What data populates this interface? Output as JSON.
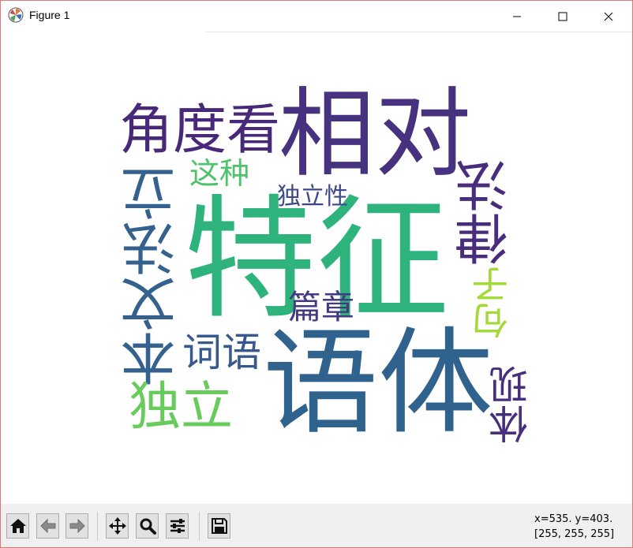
{
  "window": {
    "title": "Figure 1",
    "app_icon": "matplotlib-icon",
    "controls": {
      "minimize": "minimize-icon",
      "maximize": "maximize-icon",
      "close": "close-icon"
    }
  },
  "wordcloud": {
    "words": [
      {
        "text": "特征",
        "color": "#2eb37c"
      },
      {
        "text": "语体",
        "color": "#30628e"
      },
      {
        "text": "相对",
        "color": "#46327f"
      },
      {
        "text": "角度看",
        "color": "#482878"
      },
      {
        "text": "本文法立",
        "color": "#34618d"
      },
      {
        "text": "词语",
        "color": "#37598c"
      },
      {
        "text": "律法",
        "color": "#472d7b"
      },
      {
        "text": "句子",
        "color": "#a2da37"
      },
      {
        "text": "体现",
        "color": "#472f7d"
      },
      {
        "text": "独立",
        "color": "#67cc5c"
      },
      {
        "text": "篇章",
        "color": "#443a83"
      },
      {
        "text": "这种",
        "color": "#4ec36b"
      },
      {
        "text": "独立性",
        "color": "#3e4989"
      }
    ]
  },
  "toolbar": {
    "buttons": [
      {
        "name": "home-icon",
        "tooltip": "Reset original view"
      },
      {
        "name": "back-arrow-icon",
        "tooltip": "Back"
      },
      {
        "name": "forward-arrow-icon",
        "tooltip": "Forward"
      },
      {
        "name": "pan-move-icon",
        "tooltip": "Pan"
      },
      {
        "name": "zoom-magnifier-icon",
        "tooltip": "Zoom"
      },
      {
        "name": "subplots-sliders-icon",
        "tooltip": "Configure subplots"
      },
      {
        "name": "save-floppy-icon",
        "tooltip": "Save"
      }
    ],
    "coords_line1": "x=535. y=403.",
    "coords_line2": "[255, 255, 255]"
  }
}
